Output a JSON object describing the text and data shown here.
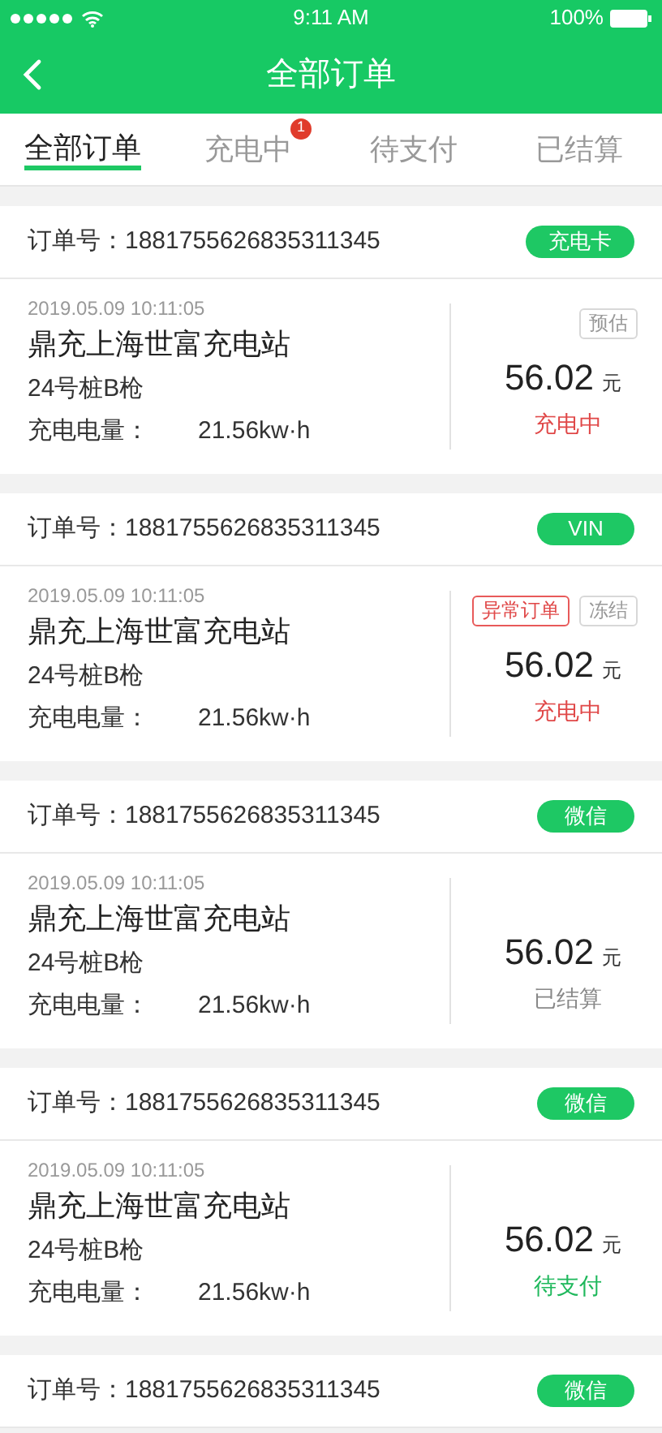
{
  "status_bar": {
    "time": "9:11 AM",
    "battery": "100%"
  },
  "nav": {
    "title": "全部订单"
  },
  "tabs": [
    {
      "label": "全部订单",
      "selected": true
    },
    {
      "label": "充电中",
      "selected": false,
      "badge": "1"
    },
    {
      "label": "待支付",
      "selected": false
    },
    {
      "label": "已结算",
      "selected": false
    }
  ],
  "orders": [
    {
      "order_no": "订单号：1881755626835311345",
      "channel": "充电卡",
      "time": "2019.05.09 10:11:05",
      "station": "鼎充上海世富充电站",
      "pile": "24号桩B枪",
      "energy_label": "充电电量：",
      "energy": "21.56kw·h",
      "tags": [
        {
          "label": "预估",
          "kind": "plain"
        }
      ],
      "amount": "56.02",
      "unit": "元",
      "status": {
        "label": "充电中",
        "kind": "charging"
      }
    },
    {
      "order_no": "订单号：1881755626835311345",
      "channel": "VIN",
      "time": "2019.05.09 10:11:05",
      "station": "鼎充上海世富充电站",
      "pile": "24号桩B枪",
      "energy_label": "充电电量：",
      "energy": "21.56kw·h",
      "tags": [
        {
          "label": "异常订单",
          "kind": "alert"
        },
        {
          "label": "冻结",
          "kind": "plain"
        }
      ],
      "amount": "56.02",
      "unit": "元",
      "status": {
        "label": "充电中",
        "kind": "charging"
      }
    },
    {
      "order_no": "订单号：1881755626835311345",
      "channel": "微信",
      "time": "2019.05.09 10:11:05",
      "station": "鼎充上海世富充电站",
      "pile": "24号桩B枪",
      "energy_label": "充电电量：",
      "energy": "21.56kw·h",
      "amount": "56.02",
      "unit": "元",
      "status": {
        "label": "已结算",
        "kind": "settled"
      }
    },
    {
      "order_no": "订单号：1881755626835311345",
      "channel": "微信",
      "time": "2019.05.09 10:11:05",
      "station": "鼎充上海世富充电站",
      "pile": "24号桩B枪",
      "energy_label": "充电电量：",
      "energy": "21.56kw·h",
      "amount": "56.02",
      "unit": "元",
      "status": {
        "label": "待支付",
        "kind": "pending"
      }
    },
    {
      "order_no": "订单号：1881755626835311345",
      "channel": "微信"
    }
  ]
}
